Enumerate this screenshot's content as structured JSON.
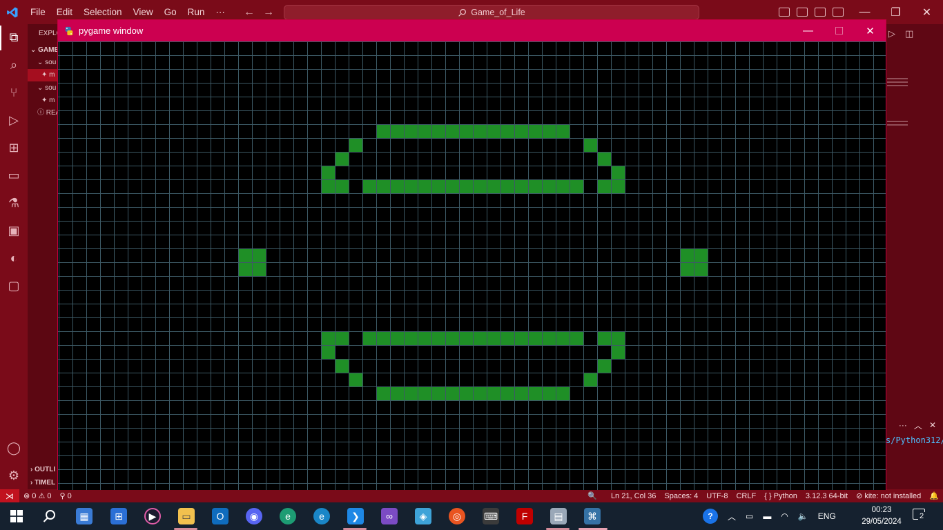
{
  "vscode": {
    "menu": [
      "File",
      "Edit",
      "Selection",
      "View",
      "Go",
      "Run",
      "···"
    ],
    "search_text": "Game_of_Life",
    "sidebar": {
      "rows": [
        "EXPLO",
        "GAME",
        "sou",
        "m",
        "sou",
        "m",
        "REA"
      ],
      "bottom": [
        "OUTLI",
        "TIMEL"
      ]
    },
    "terminal_path": "s/Python312/p",
    "status": {
      "errors": "0",
      "warnings": "0",
      "ports": "0",
      "position": "Ln 21, Col 36",
      "spaces": "Spaces: 4",
      "encoding": "UTF-8",
      "eol": "CRLF",
      "language": "Python",
      "interpreter": "3.12.3 64-bit",
      "kite": "kite: not installed"
    },
    "colors": {
      "accent": "#7a0b19",
      "sidebar": "#5c0712"
    }
  },
  "pygame": {
    "title": "pygame window",
    "titlebar_color": "#cc0050",
    "grid_line_color": "#3d5a66",
    "cell_color": "#1f8f26",
    "grid_cols": 60,
    "grid_rows": 33,
    "live_cells": [
      [
        23,
        6
      ],
      [
        24,
        6
      ],
      [
        25,
        6
      ],
      [
        26,
        6
      ],
      [
        27,
        6
      ],
      [
        28,
        6
      ],
      [
        29,
        6
      ],
      [
        30,
        6
      ],
      [
        31,
        6
      ],
      [
        32,
        6
      ],
      [
        33,
        6
      ],
      [
        34,
        6
      ],
      [
        35,
        6
      ],
      [
        36,
        6
      ],
      [
        21,
        7
      ],
      [
        38,
        7
      ],
      [
        20,
        8
      ],
      [
        39,
        8
      ],
      [
        19,
        9
      ],
      [
        40,
        9
      ],
      [
        19,
        10
      ],
      [
        20,
        10
      ],
      [
        22,
        10
      ],
      [
        23,
        10
      ],
      [
        24,
        10
      ],
      [
        25,
        10
      ],
      [
        26,
        10
      ],
      [
        27,
        10
      ],
      [
        28,
        10
      ],
      [
        29,
        10
      ],
      [
        30,
        10
      ],
      [
        31,
        10
      ],
      [
        32,
        10
      ],
      [
        33,
        10
      ],
      [
        34,
        10
      ],
      [
        35,
        10
      ],
      [
        36,
        10
      ],
      [
        37,
        10
      ],
      [
        39,
        10
      ],
      [
        40,
        10
      ],
      [
        13,
        15
      ],
      [
        14,
        15
      ],
      [
        13,
        16
      ],
      [
        14,
        16
      ],
      [
        45,
        15
      ],
      [
        46,
        15
      ],
      [
        45,
        16
      ],
      [
        46,
        16
      ],
      [
        19,
        21
      ],
      [
        20,
        21
      ],
      [
        22,
        21
      ],
      [
        23,
        21
      ],
      [
        24,
        21
      ],
      [
        25,
        21
      ],
      [
        26,
        21
      ],
      [
        27,
        21
      ],
      [
        28,
        21
      ],
      [
        29,
        21
      ],
      [
        30,
        21
      ],
      [
        31,
        21
      ],
      [
        32,
        21
      ],
      [
        33,
        21
      ],
      [
        34,
        21
      ],
      [
        35,
        21
      ],
      [
        36,
        21
      ],
      [
        37,
        21
      ],
      [
        39,
        21
      ],
      [
        40,
        21
      ],
      [
        19,
        22
      ],
      [
        40,
        22
      ],
      [
        20,
        23
      ],
      [
        39,
        23
      ],
      [
        21,
        24
      ],
      [
        38,
        24
      ],
      [
        23,
        25
      ],
      [
        24,
        25
      ],
      [
        25,
        25
      ],
      [
        26,
        25
      ],
      [
        27,
        25
      ],
      [
        28,
        25
      ],
      [
        29,
        25
      ],
      [
        30,
        25
      ],
      [
        31,
        25
      ],
      [
        32,
        25
      ],
      [
        33,
        25
      ],
      [
        34,
        25
      ],
      [
        35,
        25
      ],
      [
        36,
        25
      ]
    ]
  },
  "taskbar": {
    "apps": [
      "start-icon",
      "search-icon",
      "widget-icon",
      "store-icon",
      "media-player-icon",
      "file-explorer-icon",
      "outlook-icon",
      "discord-icon",
      "edge-dev-icon",
      "edge-beta-icon",
      "vscode-icon",
      "visual-studio-icon",
      "box-icon",
      "ubuntu-icon",
      "terminal-icon",
      "filezilla-icon",
      "remote-desktop-icon",
      "python-icon"
    ],
    "language": "ENG",
    "time": "00:23",
    "date": "29/05/2024",
    "notifications": "2"
  }
}
